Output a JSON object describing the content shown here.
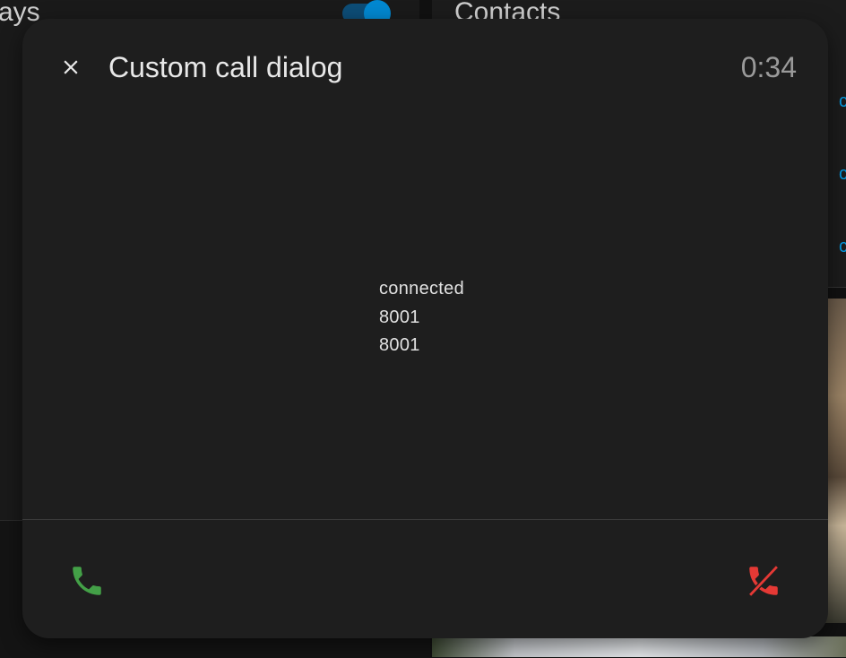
{
  "background": {
    "left_title": "ays",
    "right_title": "Contacts",
    "contact_links": [
      "c",
      "c",
      "c"
    ]
  },
  "dialog": {
    "title": "Custom call dialog",
    "timer": "0:34",
    "status": "connected",
    "line1": "8001",
    "line2": "8001",
    "icons": {
      "close": "close-icon",
      "answer": "phone-icon",
      "hangup": "phone-hangup-icon"
    },
    "colors": {
      "answer": "#43a047",
      "hangup": "#e53935"
    }
  }
}
